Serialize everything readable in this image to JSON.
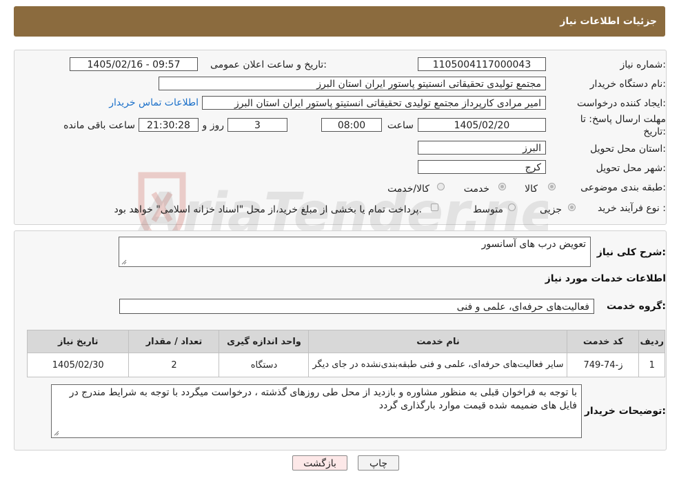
{
  "header": {
    "title": "جزئیات اطلاعات نیاز"
  },
  "watermark": {
    "text": "AriaTender.net"
  },
  "form": {
    "need_number_label": "شماره نیاز:",
    "need_number": "1105004117000043",
    "announce_label": "تاریخ و ساعت اعلان عمومی:",
    "announce_value": "1405/02/16 - 09:57",
    "buyer_org_label": "نام دستگاه خریدار:",
    "buyer_org": "مجتمع تولیدی تحقیقاتی انستیتو پاستور ایران استان البرز",
    "creator_label": "ایجاد کننده درخواست:",
    "creator": "امیر مرادی کارپرداز مجتمع تولیدی تحقیقاتی انستیتو پاستور ایران استان البرز",
    "contact_link": "اطلاعات تماس خریدار",
    "deadline_label_1": "مهلت ارسال پاسخ: تا",
    "deadline_label_2": "تاریخ:",
    "deadline_date": "1405/02/20",
    "time_label": "ساعت",
    "deadline_time": "08:00",
    "days_value": "3",
    "days_label": "روز و",
    "remaining_time": "21:30:28",
    "remaining_label": "ساعت باقی مانده",
    "province_label": "استان محل تحویل:",
    "province": "البرز",
    "city_label": "شهر محل تحویل:",
    "city": "کرج",
    "category_label": "طبقه بندی موضوعی:",
    "category_options": [
      "کالا",
      "خدمت",
      "کالا/خدمت"
    ],
    "process_label": "نوع فرآیند خرید :",
    "process_options": [
      "جزیی",
      "متوسط"
    ],
    "process_note": "پرداخت تمام یا بخشی از مبلغ خرید،از محل \"اسناد خزانه اسلامی\" خواهد بود."
  },
  "details": {
    "summary_label": "شرح کلی نیاز:",
    "summary": "تعویض درب های آسانسور",
    "services_heading": "اطلاعات خدمات مورد نیاز",
    "service_group_label": "گروه خدمت:",
    "service_group": "فعالیت‌های حرفه‌ای، علمی و فنی"
  },
  "table": {
    "headers": [
      "ردیف",
      "کد خدمت",
      "نام خدمت",
      "واحد اندازه گیری",
      "تعداد / مقدار",
      "تاریخ نیاز"
    ],
    "rows": [
      [
        "1",
        "ز-74-749",
        "سایر فعالیت‌های حرفه‌ای، علمی و فنی طبقه‌بندی‌نشده در جای دیگر",
        "دستگاه",
        "2",
        "1405/02/30"
      ]
    ]
  },
  "buyer_notes": {
    "label": "توضیحات خریدار:",
    "text": "با توجه به فراخوان قبلی به منظور مشاوره و بازدید از محل طی روزهای گذشته ، درخواست میگردد با توجه به شرایط مندرج در فایل های ضمیمه شده قیمت موارد بارگذاری گردد"
  },
  "buttons": {
    "print": "چاپ",
    "back": "بازگشت"
  },
  "colors": {
    "header_bg": "#8B6B3E",
    "link": "#1a6fc9",
    "back_button": "#fde8e8"
  }
}
